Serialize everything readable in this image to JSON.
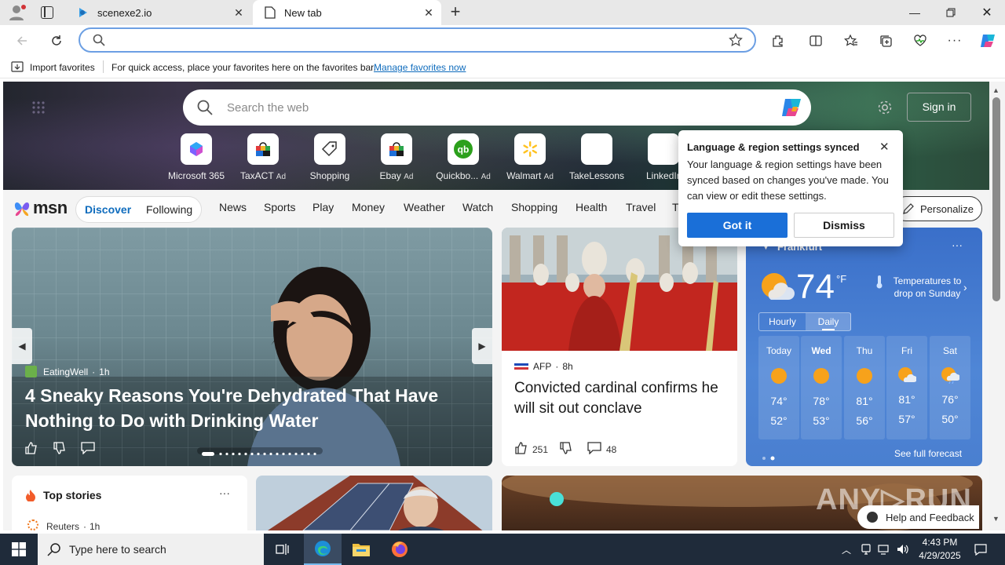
{
  "browser": {
    "tabs": [
      {
        "title": "scenexe2.io"
      },
      {
        "title": "New tab"
      }
    ],
    "favorites_bar": {
      "import_label": "Import favorites",
      "hint": "For quick access, place your favorites here on the favorites bar.",
      "manage_link": "Manage favorites now"
    }
  },
  "msn": {
    "search_placeholder": "Search the web",
    "sign_in": "Sign in",
    "shortcuts": [
      {
        "label": "Microsoft 365",
        "ad": ""
      },
      {
        "label": "TaxACT",
        "ad": "Ad"
      },
      {
        "label": "Shopping",
        "ad": ""
      },
      {
        "label": "Ebay",
        "ad": "Ad"
      },
      {
        "label": "Quickbo...",
        "ad": "Ad"
      },
      {
        "label": "Walmart",
        "ad": "Ad"
      },
      {
        "label": "TakeLessons",
        "ad": ""
      },
      {
        "label": "LinkedIn",
        "ad": ""
      }
    ],
    "logo": "msn",
    "nav": {
      "discover": "Discover",
      "following": "Following",
      "links": [
        "News",
        "Sports",
        "Play",
        "Money",
        "Weather",
        "Watch",
        "Shopping",
        "Health",
        "Travel",
        "T"
      ],
      "personalize": "Personalize"
    },
    "hero_story": {
      "source": "EatingWell",
      "age": "1h",
      "headline": "4 Sneaky Reasons You're Dehydrated That Have Nothing to Do with Drinking Water"
    },
    "side_story": {
      "source": "AFP",
      "age": "8h",
      "headline": "Convicted cardinal confirms he will sit out conclave",
      "likes": "251",
      "comments": "48"
    },
    "weather": {
      "city": "Frankfurt",
      "temp": "74",
      "unit": "°F",
      "note": "Temperatures to drop on Sunday",
      "tab_hourly": "Hourly",
      "tab_daily": "Daily",
      "days": [
        {
          "name": "Today",
          "high": "74°",
          "low": "52°"
        },
        {
          "name": "Wed",
          "high": "78°",
          "low": "53°"
        },
        {
          "name": "Thu",
          "high": "81°",
          "low": "56°"
        },
        {
          "name": "Fri",
          "high": "81°",
          "low": "57°"
        },
        {
          "name": "Sat",
          "high": "76°",
          "low": "50°"
        }
      ],
      "see_full": "See full forecast"
    },
    "top_stories": {
      "title": "Top stories",
      "first_source": "Reuters",
      "first_age": "1h"
    },
    "help_feedback": "Help and Feedback"
  },
  "popup": {
    "title": "Language & region settings synced",
    "body": "Your language & region settings have been synced based on changes you've made. You can view or edit these settings.",
    "got_it": "Got it",
    "dismiss": "Dismiss"
  },
  "taskbar": {
    "search_placeholder": "Type here to search",
    "time": "4:43 PM",
    "date": "4/29/2025"
  },
  "colors": {
    "accent": "#0f6cbd",
    "button_blue": "#1a6fd8",
    "taskbar": "#1f2b3a"
  }
}
